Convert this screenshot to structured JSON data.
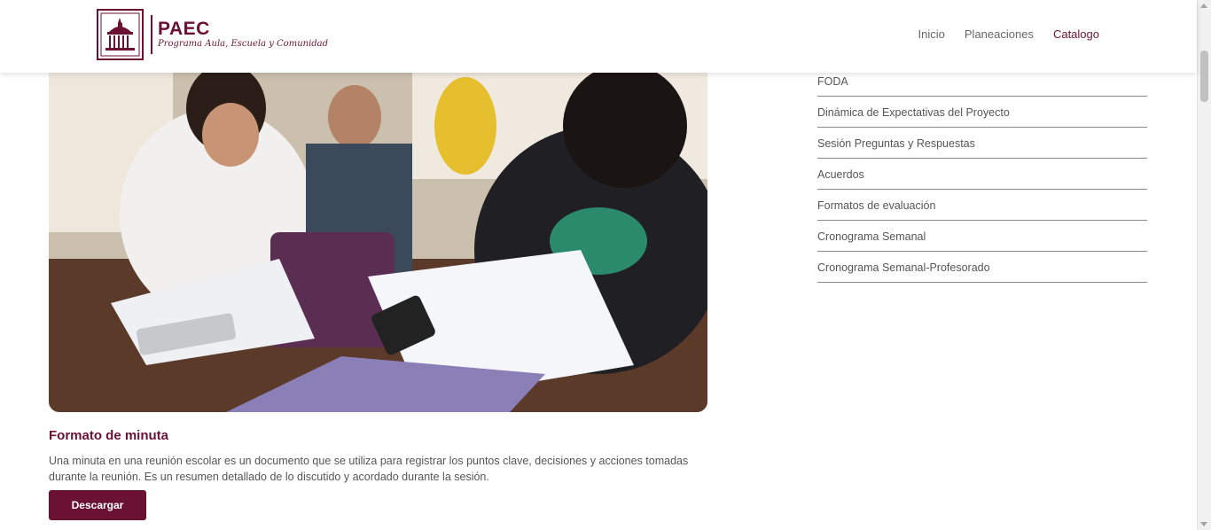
{
  "header": {
    "logo_title": "PAEC",
    "logo_subtitle": "Programa Aula, Escuela y Comunidad",
    "nav": [
      {
        "label": "Inicio",
        "active": false
      },
      {
        "label": "Planeaciones",
        "active": false
      },
      {
        "label": "Catalogo",
        "active": true
      }
    ]
  },
  "main": {
    "image_alt": "students studying",
    "title": "Formato de minuta",
    "description": "Una minuta en una reunión escolar es un documento que se utiliza para registrar los puntos clave, decisiones y acciones tomadas durante la reunión. Es un resumen detallado de lo discutido y acordado durante la sesión.",
    "button_label": "Descargar"
  },
  "sidebar": {
    "items": [
      {
        "label": "FODA"
      },
      {
        "label": "Dinámica de Expectativas del Proyecto"
      },
      {
        "label": "Sesión Preguntas y Respuestas"
      },
      {
        "label": "Acuerdos"
      },
      {
        "label": "Formatos de evaluación"
      },
      {
        "label": "Cronograma Semanal"
      },
      {
        "label": "Cronograma Semanal-Profesorado"
      }
    ]
  },
  "colors": {
    "brand": "#6b1232",
    "text": "#555555"
  }
}
